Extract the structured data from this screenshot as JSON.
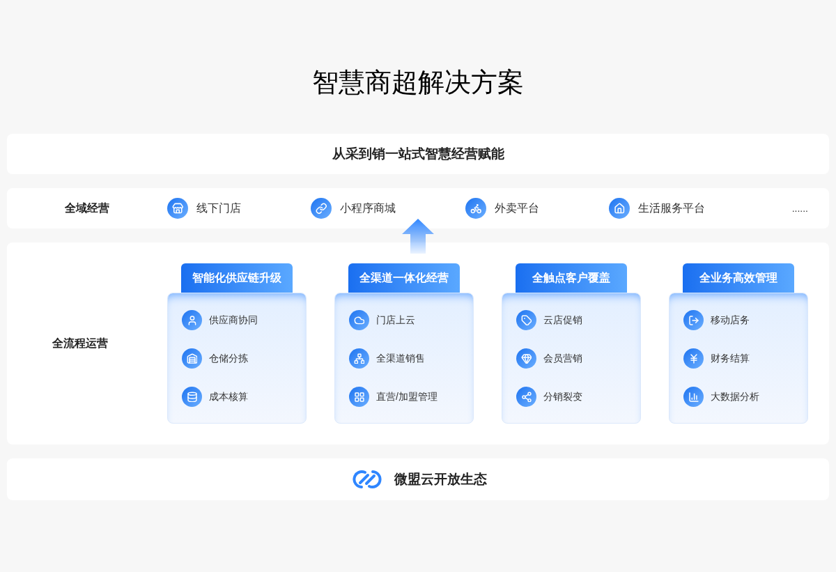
{
  "title": "智慧商超解决方案",
  "banner": "从采到销一站式智慧经营赋能",
  "channels": {
    "label": "全域经营",
    "items": [
      "线下门店",
      "小程序商城",
      "外卖平台",
      "生活服务平台"
    ],
    "more": "......"
  },
  "process": {
    "label": "全流程运营",
    "columns": [
      {
        "heading": "智能化供应链升级",
        "items": [
          "供应商协同",
          "仓储分拣",
          "成本核算"
        ]
      },
      {
        "heading": "全渠道一体化经营",
        "items": [
          "门店上云",
          "全渠道销售",
          "直营/加盟管理"
        ]
      },
      {
        "heading": "全触点客户覆盖",
        "items": [
          "云店促销",
          "会员营销",
          "分销裂变"
        ]
      },
      {
        "heading": "全业务高效管理",
        "items": [
          "移动店务",
          "财务结算",
          "大数据分析"
        ]
      }
    ]
  },
  "ecosystem": "微盟云开放生态"
}
